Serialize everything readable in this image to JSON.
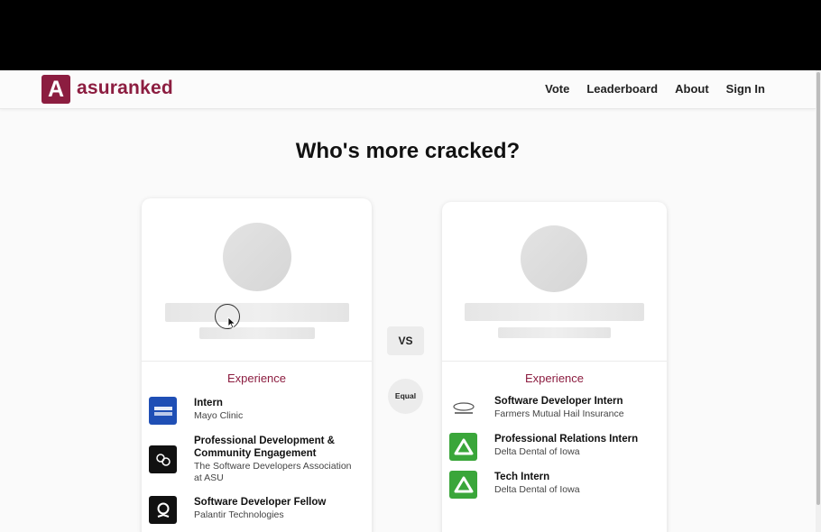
{
  "brand": {
    "logo_letter": "A",
    "name": "asuranked",
    "accent": "#8c1d40"
  },
  "nav": {
    "links": [
      "Vote",
      "Leaderboard",
      "About",
      "Sign In"
    ]
  },
  "headline": "Who's more cracked?",
  "vs_label": "VS",
  "equal_label": "Equal",
  "left_card": {
    "section_title": "Experience",
    "experience": [
      {
        "role": "Intern",
        "org": "Mayo Clinic",
        "icon": "mayo-clinic-logo-icon"
      },
      {
        "role": "Professional Development & Community Engagement",
        "org": "The Software Developers Association at ASU",
        "icon": "sda-logo-icon"
      },
      {
        "role": "Software Developer Fellow",
        "org": "Palantir Technologies",
        "icon": "palantir-logo-icon"
      }
    ]
  },
  "right_card": {
    "section_title": "Experience",
    "experience": [
      {
        "role": "Software Developer Intern",
        "org": "Farmers Mutual Hail Insurance",
        "icon": "farmers-mutual-hail-logo-icon"
      },
      {
        "role": "Professional Relations Intern",
        "org": "Delta Dental of Iowa",
        "icon": "delta-dental-logo-icon"
      },
      {
        "role": "Tech Intern",
        "org": "Delta Dental of Iowa",
        "icon": "delta-dental-logo-icon"
      }
    ]
  },
  "colors": {
    "mayo_blue": "#1f4fb5",
    "delta_green": "#3aa63a",
    "dark_icon": "#111111"
  }
}
